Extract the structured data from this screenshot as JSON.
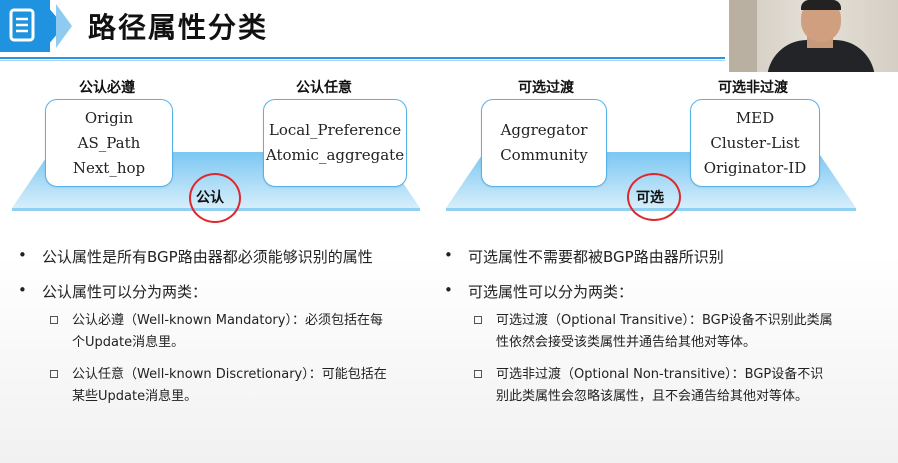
{
  "header": {
    "title": "路径属性分类"
  },
  "diagram": {
    "left": {
      "cat_a": "公认必遵",
      "box_a": [
        "Origin",
        "AS_Path",
        "Next_hop"
      ],
      "cat_b": "公认任意",
      "box_b": [
        "Local_Preference",
        "Atomic_aggregate"
      ],
      "center": "公认"
    },
    "right": {
      "cat_a": "可选过渡",
      "box_a": [
        "Aggregator",
        "Community"
      ],
      "cat_b": "可选非过渡",
      "box_b": [
        "MED",
        "Cluster-List",
        "Originator-ID"
      ],
      "center": "可选"
    }
  },
  "bullets": {
    "left": {
      "b1": "公认属性是所有BGP路由器都必须能够识别的属性",
      "b2": "公认属性可以分为两类：",
      "s1_l1": "公认必遵（Well-known Mandatory）：必须包括在每",
      "s1_l2": "个Update消息里。",
      "s2_l1": "公认任意（Well-known Discretionary）：可能包括在",
      "s2_l2": "某些Update消息里。"
    },
    "right": {
      "b1": "可选属性不需要都被BGP路由器所识别",
      "b2": "可选属性可以分为两类：",
      "s1_l1": "可选过渡（Optional Transitive）：BGP设备不识别此类属",
      "s1_l2": "性依然会接受该类属性并通告给其他对等体。",
      "s2_l1": "可选非过渡（Optional Non-transitive）：BGP设备不识",
      "s2_l2": "别此类属性会忽略该属性，且不会通告给其他对等体。"
    }
  },
  "colors": {
    "accent": "#1f93e0",
    "annotation": "#e0282a"
  }
}
